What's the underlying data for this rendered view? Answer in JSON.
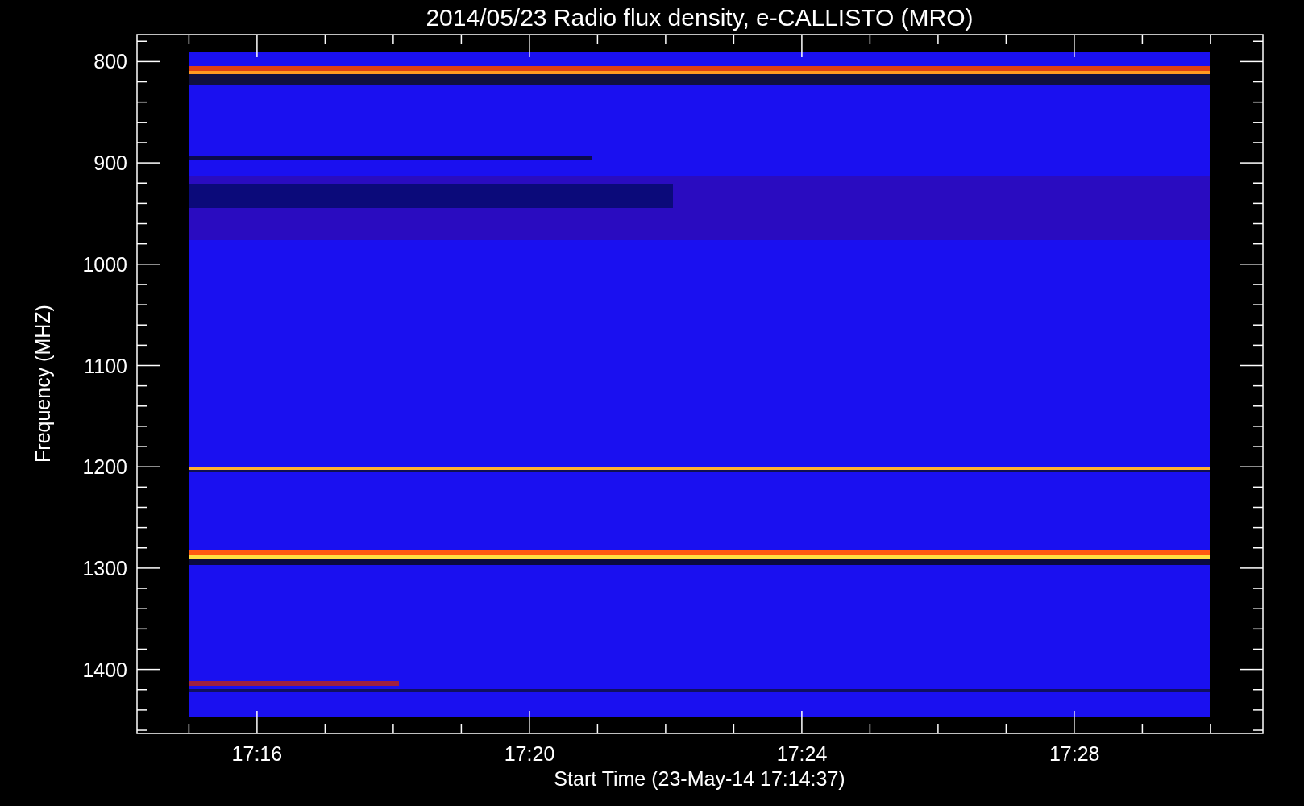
{
  "title": "2014/05/23  Radio flux density, e-CALLISTO (MRO)",
  "y_axis": {
    "label": "Frequency (MHZ)",
    "ticks": [
      "800",
      "900",
      "1000",
      "1100",
      "1200",
      "1300",
      "1400"
    ]
  },
  "x_axis": {
    "label": "Start Time (23-May-14 17:14:37)",
    "ticks": [
      "17:16",
      "17:20",
      "17:24",
      "17:28"
    ]
  }
}
